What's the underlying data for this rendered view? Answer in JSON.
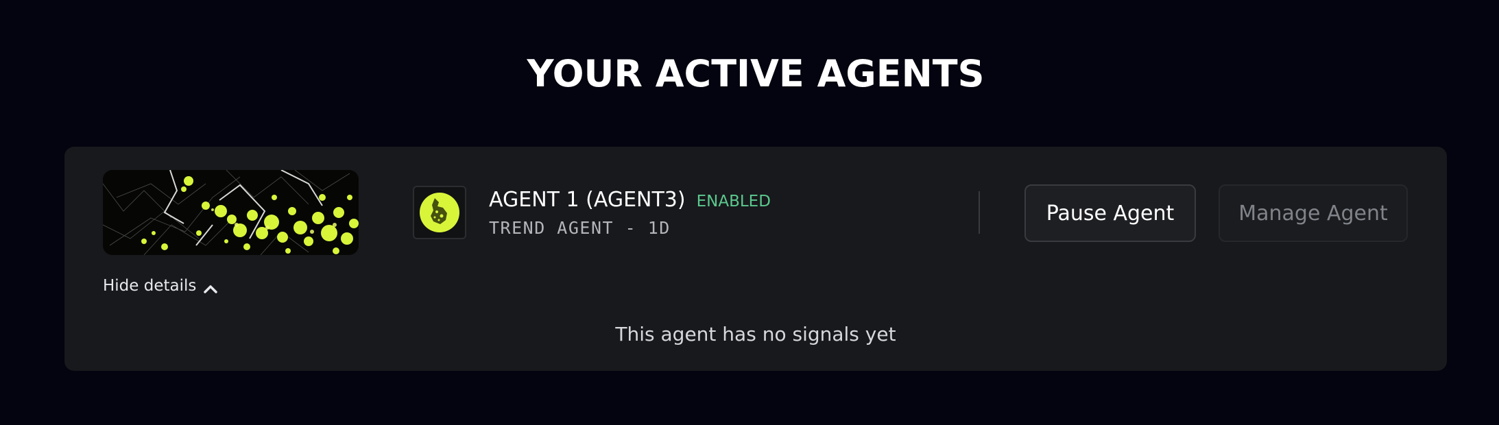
{
  "page": {
    "title": "YOUR ACTIVE AGENTS"
  },
  "agent": {
    "name": "AGENT 1 (AGENT3)",
    "status": "ENABLED",
    "type": "TREND AGENT - 1D",
    "banner_icon": "abstract-art-image",
    "avatar_icon": "agent-avatar-icon",
    "pause_label": "Pause Agent",
    "manage_label": "Manage Agent",
    "details_toggle_label": "Hide details",
    "details_toggle_icon": "chevron-up-icon",
    "empty_message": "This agent has no signals yet"
  },
  "colors": {
    "background": "#03040f",
    "card": "#18191c",
    "accent": "#d9f53a",
    "status_enabled": "#5bc98f",
    "button_border": "#3a3b40",
    "disabled_text": "#80838a"
  }
}
